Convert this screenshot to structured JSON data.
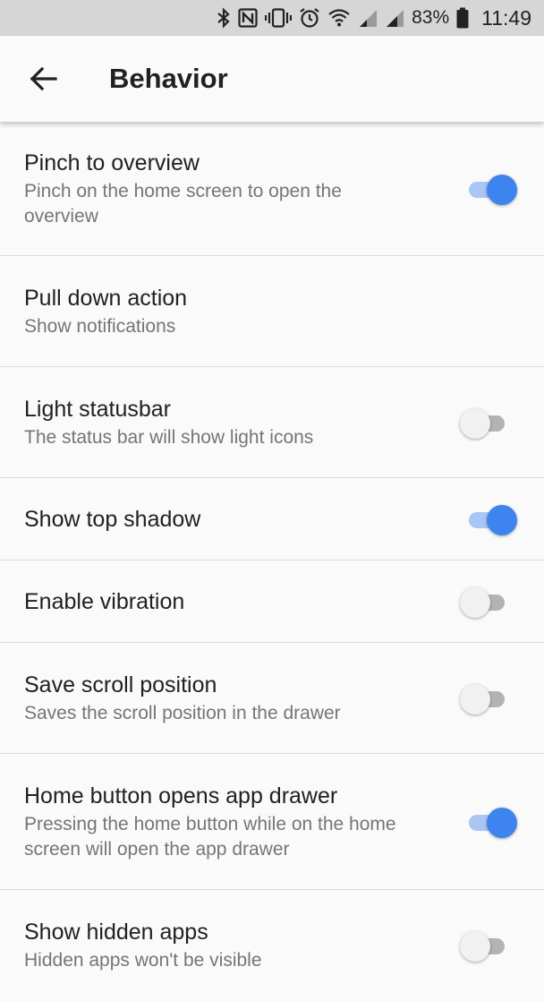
{
  "status_bar": {
    "battery_percent": "83%",
    "time": "11:49",
    "icons": [
      "bluetooth-icon",
      "nfc-icon",
      "vibrate-icon",
      "alarm-icon",
      "wifi-icon",
      "signal-icon",
      "signal-icon",
      "battery-icon"
    ]
  },
  "app_bar": {
    "title": "Behavior",
    "back_icon": "arrow-left-icon"
  },
  "settings": [
    {
      "title": "Pinch to overview",
      "subtitle": "Pinch on the home screen to open the overview",
      "toggle": true
    },
    {
      "title": "Pull down action",
      "subtitle": "Show notifications",
      "toggle": null
    },
    {
      "title": "Light statusbar",
      "subtitle": "The status bar will show light icons",
      "toggle": false
    },
    {
      "title": "Show top shadow",
      "subtitle": "",
      "toggle": true
    },
    {
      "title": "Enable vibration",
      "subtitle": "",
      "toggle": false
    },
    {
      "title": "Save scroll position",
      "subtitle": "Saves the scroll position in the drawer",
      "toggle": false
    },
    {
      "title": "Home button opens app drawer",
      "subtitle": "Pressing the home button while on the home screen will open the app drawer",
      "toggle": true
    },
    {
      "title": "Show hidden apps",
      "subtitle": "Hidden apps won't be visible",
      "toggle": false
    }
  ],
  "colors": {
    "accent": "#3d84ef",
    "accent_track": "#a9c6f5",
    "background": "#fafafa",
    "status_bar_bg": "#d6d6d6"
  }
}
